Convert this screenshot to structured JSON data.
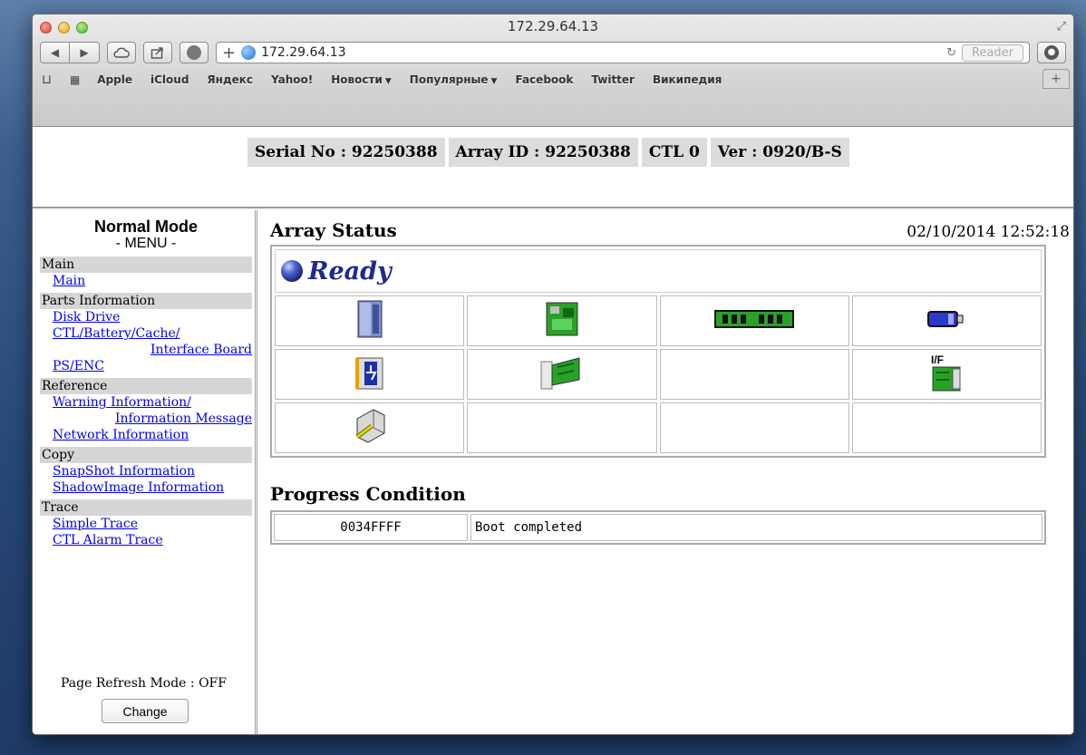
{
  "browser": {
    "window_title": "172.29.64.13",
    "url": "172.29.64.13",
    "reader_label": "Reader",
    "bookmarks": [
      {
        "label": "Apple",
        "dropdown": false
      },
      {
        "label": "iCloud",
        "dropdown": false
      },
      {
        "label": "Яндекс",
        "dropdown": false
      },
      {
        "label": "Yahoo!",
        "dropdown": false
      },
      {
        "label": "Новости",
        "dropdown": true
      },
      {
        "label": "Популярные",
        "dropdown": true
      },
      {
        "label": "Facebook",
        "dropdown": false
      },
      {
        "label": "Twitter",
        "dropdown": false
      },
      {
        "label": "Википедия",
        "dropdown": false
      }
    ]
  },
  "header": {
    "serial": "Serial No : 92250388",
    "array_id": "Array ID : 92250388",
    "ctl": "CTL 0",
    "ver": "Ver : 0920/B-S"
  },
  "menu": {
    "mode_title": "Normal Mode",
    "menu_title": "- MENU -",
    "sections": [
      {
        "title": "Main",
        "links": [
          {
            "label": "Main"
          }
        ]
      },
      {
        "title": "Parts Information",
        "links": [
          {
            "label": "Disk Drive"
          },
          {
            "label": "CTL/Battery/Cache/",
            "continuation": "Interface Board"
          },
          {
            "label": "PS/ENC"
          }
        ]
      },
      {
        "title": "Reference",
        "links": [
          {
            "label": "Warning Information/",
            "continuation": "Information Message"
          },
          {
            "label": "Network Information"
          }
        ]
      },
      {
        "title": "Copy",
        "links": [
          {
            "label": "SnapShot Information"
          },
          {
            "label": "ShadowImage Information"
          }
        ]
      },
      {
        "title": "Trace",
        "links": [
          {
            "label": "Simple Trace"
          },
          {
            "label": "CTL Alarm Trace"
          }
        ]
      }
    ],
    "refresh_text": "Page Refresh Mode : OFF",
    "change_label": "Change"
  },
  "main": {
    "array_status_title": "Array Status",
    "datetime": "02/10/2014 12:52:18",
    "status": "Ready",
    "component_icons": [
      [
        "disk-drive-icon",
        "controller-board-icon",
        "cache-memory-icon",
        "battery-icon"
      ],
      [
        "power-supply-icon",
        "board-module-icon",
        "",
        "interface-board-icon"
      ],
      [
        "fan-module-icon",
        "",
        "",
        ""
      ]
    ],
    "interface_badge": "I/F",
    "progress_title": "Progress Condition",
    "progress": {
      "code": "0034FFFF",
      "message": "Boot completed"
    }
  },
  "colors": {
    "status_text": "#1f2a8c",
    "link": "#0000ee",
    "section_bg": "#d6d6d6",
    "header_cell_bg": "#dcdcdc"
  }
}
